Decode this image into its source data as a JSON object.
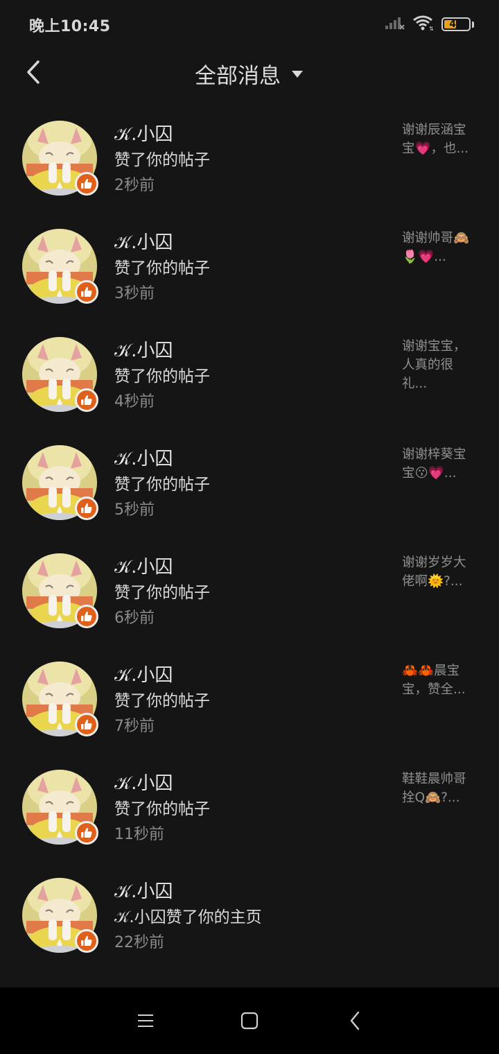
{
  "status_bar": {
    "time": "晚上10:45",
    "battery_level": "46",
    "battery_percent": 46
  },
  "header": {
    "title": "全部消息"
  },
  "messages": [
    {
      "name": "𝒦.小囚",
      "action": "赞了你的帖子",
      "time": "2秒前",
      "preview": "谢谢辰涵宝\n宝💗，也..."
    },
    {
      "name": "𝒦.小囚",
      "action": "赞了你的帖子",
      "time": "3秒前",
      "preview": "谢谢帅哥🙈\n🌷💗..."
    },
    {
      "name": "𝒦.小囚",
      "action": "赞了你的帖子",
      "time": "4秒前",
      "preview": "谢谢宝宝，\n人真的很\n礼..."
    },
    {
      "name": "𝒦.小囚",
      "action": "赞了你的帖子",
      "time": "5秒前",
      "preview": "谢谢梓葵宝\n宝😗💗..."
    },
    {
      "name": "𝒦.小囚",
      "action": "赞了你的帖子",
      "time": "6秒前",
      "preview": "谢谢岁岁大\n佬啊🌞?..."
    },
    {
      "name": "𝒦.小囚",
      "action": "赞了你的帖子",
      "time": "7秒前",
      "preview": "🦀🦀晨宝\n宝，赞全..."
    },
    {
      "name": "𝒦.小囚",
      "action": "赞了你的帖子",
      "time": "11秒前",
      "preview": "鞋鞋晨帅哥\n拴Q🙈?..."
    },
    {
      "name": "𝒦.小囚",
      "action": "𝒦.小囚赞了你的主页",
      "time": "22秒前",
      "preview": ""
    }
  ],
  "colors": {
    "background": "#151515",
    "like_badge": "#e0601a",
    "battery_fill": "#e6a11f",
    "nav_bar": "#000000"
  },
  "icons": {
    "back": "chevron-left-icon",
    "dropdown": "caret-down-icon",
    "like": "thumbs-up-icon",
    "nav_menu": "menu-icon",
    "nav_home": "home-square-icon",
    "nav_back": "back-icon"
  }
}
